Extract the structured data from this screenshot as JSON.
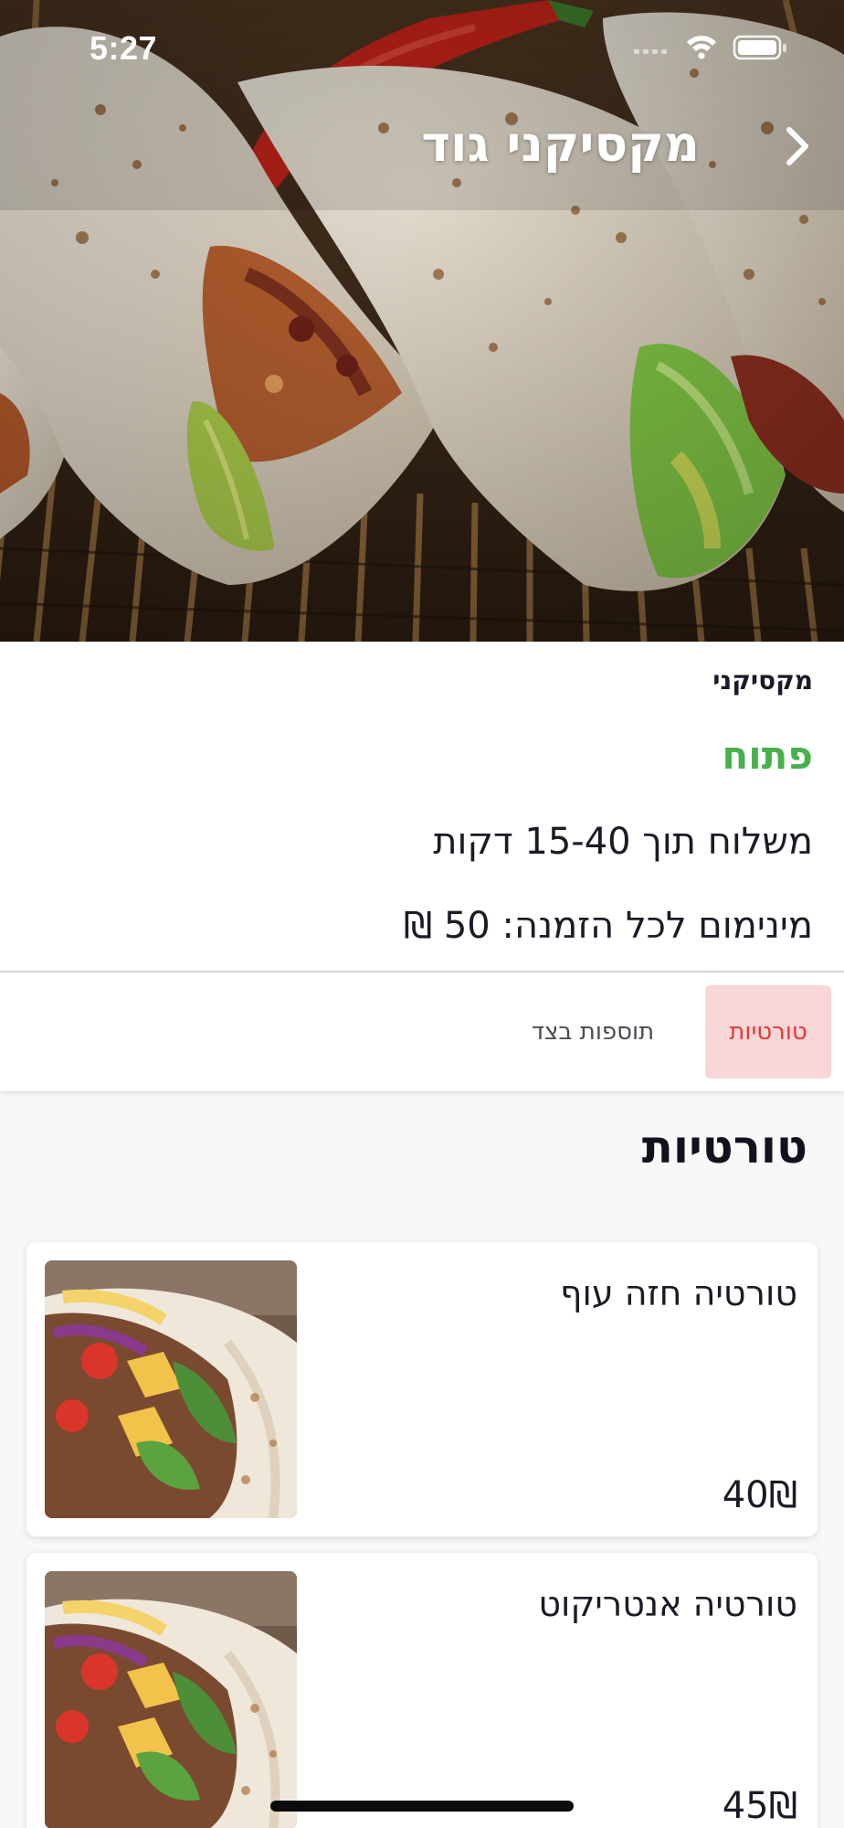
{
  "status_bar": {
    "time": "5:27"
  },
  "header": {
    "title": "מקסיקני גוד",
    "back_icon": "chevron-right-icon"
  },
  "hero_image": "tortilla-wraps-photo",
  "restaurant": {
    "category": "מקסיקני",
    "status": "פתוח",
    "status_color": "#47b04b",
    "delivery_time": "משלוח תוך 15-40 דקות",
    "minimum_order": "מינימום לכל הזמנה:  50 ₪"
  },
  "tabs": [
    {
      "label": "טורטיות",
      "active": true
    },
    {
      "label": "תוספות בצד",
      "active": false
    }
  ],
  "accent_color": "#e53935",
  "section": {
    "title": "טורטיות"
  },
  "menu_items": [
    {
      "name": "טורטיה חזה עוף",
      "price": "40₪",
      "image": "tortilla-photo"
    },
    {
      "name": "טורטיה אנטריקוט",
      "price": "45₪",
      "image": "tortilla-photo"
    }
  ]
}
